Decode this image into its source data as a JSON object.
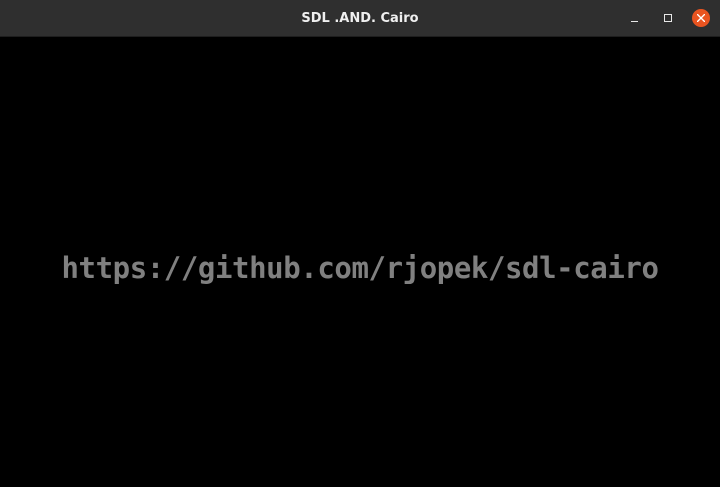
{
  "window": {
    "title": "SDL .AND. Cairo",
    "controls": {
      "minimize_icon": "minimize-icon",
      "maximize_icon": "maximize-icon",
      "close_icon": "close-icon"
    }
  },
  "canvas": {
    "text": "https://github.com/rjopek/sdl-cairo"
  },
  "colors": {
    "titlebar": "#2f2f2f",
    "canvas_background": "#000000",
    "text": "#808080",
    "close_button": "#e95420"
  }
}
